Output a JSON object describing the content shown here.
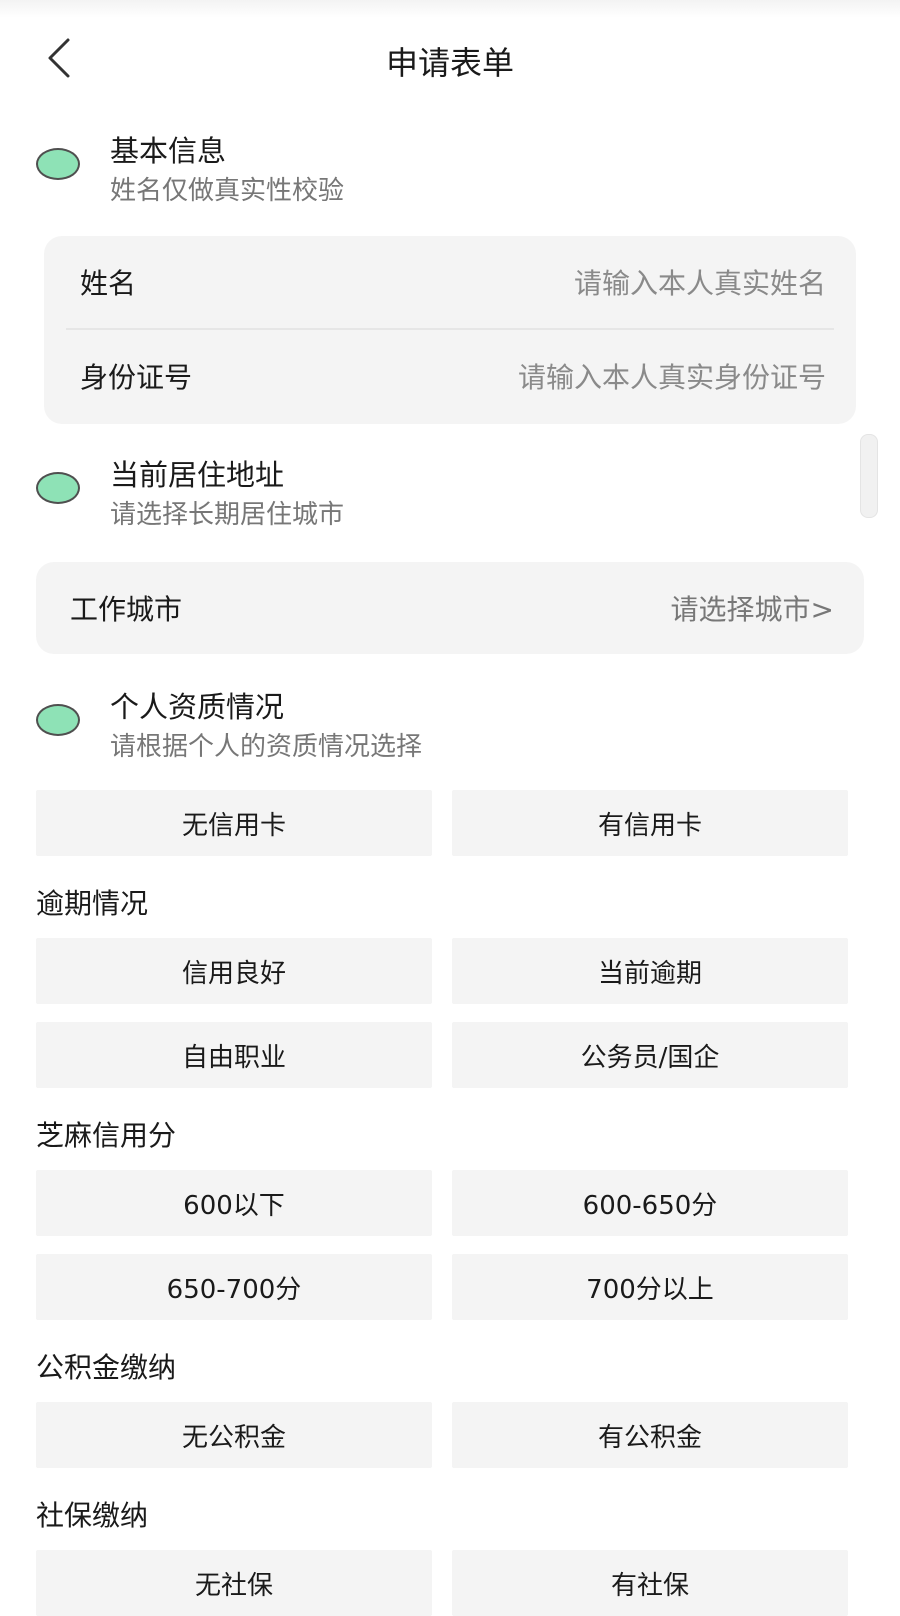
{
  "header": {
    "title": "申请表单"
  },
  "basic": {
    "title": "基本信息",
    "subtitle": "姓名仅做真实性校验",
    "name_label": "姓名",
    "name_placeholder": "请输入本人真实姓名",
    "id_label": "身份证号",
    "id_placeholder": "请输入本人真实身份证号"
  },
  "address": {
    "title": "当前居住地址",
    "subtitle": "请选择长期居住城市",
    "city_label": "工作城市",
    "city_value": "请选择城市>"
  },
  "qualification": {
    "title": "个人资质情况",
    "subtitle": "请根据个人的资质情况选择",
    "credit_card": [
      "无信用卡",
      "有信用卡"
    ],
    "overdue_label": "逾期情况",
    "overdue": [
      "信用良好",
      "当前逾期",
      "自由职业",
      "公务员/国企"
    ],
    "sesame_label": "芝麻信用分",
    "sesame": [
      "600以下",
      "600-650分",
      "650-700分",
      "700分以上"
    ],
    "fund_label": "公积金缴纳",
    "fund": [
      "无公积金",
      "有公积金"
    ],
    "social_label": "社保缴纳",
    "social": [
      "无社保",
      "有社保"
    ]
  },
  "colors": {
    "accent_dot": "#8ee2b6",
    "card_bg": "#f4f4f4",
    "placeholder": "#8a8a8a"
  }
}
